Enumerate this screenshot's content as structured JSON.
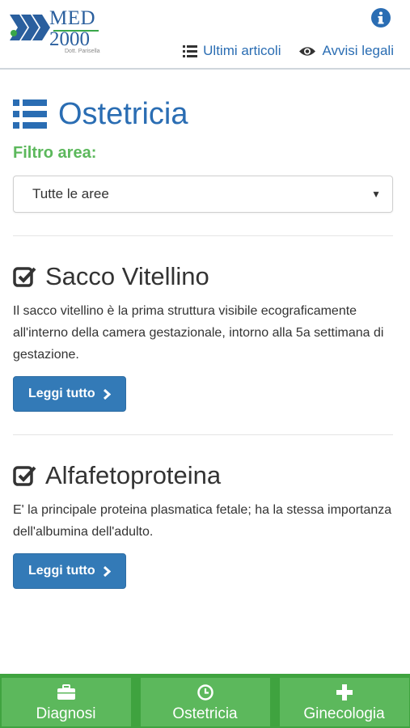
{
  "logo": {
    "brand": "MED",
    "year": "2000",
    "subtitle": "Dott. Parisella"
  },
  "header": {
    "nav": [
      {
        "label": "Ultimi articoli",
        "icon": "list-icon"
      },
      {
        "label": "Avvisi legali",
        "icon": "eye-icon"
      }
    ],
    "info_icon": "info-circle-icon"
  },
  "page": {
    "title": "Ostetricia",
    "title_icon": "list-icon",
    "filter_label": "Filtro area:",
    "filter_value": "Tutte le aree"
  },
  "articles": [
    {
      "title": "Sacco Vitellino",
      "body": "Il sacco vitellino è la prima struttura visibile ecograficamente all'interno della camera gestazionale, intorno alla 5a settimana di gestazione.",
      "button": "Leggi tutto"
    },
    {
      "title": "Alfafetoproteina",
      "body": "E' la principale proteina plasmatica fetale; ha la stessa importanza dell'albumina dell'adulto.",
      "button": "Leggi tutto"
    }
  ],
  "bottom_tabs": [
    {
      "label": "Diagnosi",
      "icon": "briefcase-icon"
    },
    {
      "label": "Ostetricia",
      "icon": "clock-icon"
    },
    {
      "label": "Ginecologia",
      "icon": "plus-icon"
    }
  ],
  "colors": {
    "primary": "#337ab7",
    "title_blue": "#2a6db3",
    "green": "#5cb85c",
    "green_bar": "#3fa33f"
  }
}
